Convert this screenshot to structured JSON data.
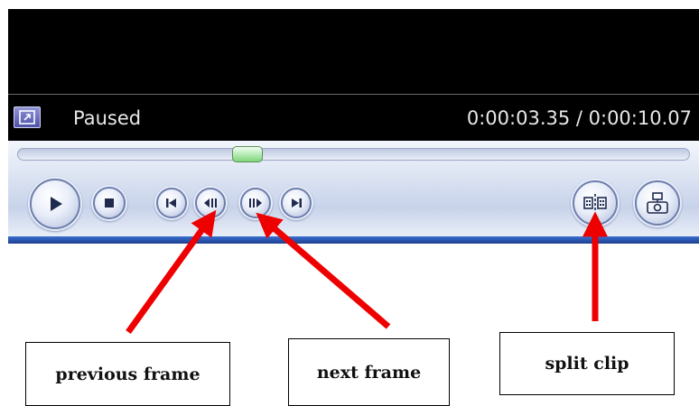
{
  "player": {
    "status": "Paused",
    "time": "0:00:03.35 / 0:00:10.07",
    "seek_progress": 0.35
  },
  "controls": {
    "play": {
      "icon": "play-icon"
    },
    "stop": {
      "icon": "stop-icon"
    },
    "previous": {
      "icon": "skip-back-icon"
    },
    "previous_frame": {
      "icon": "previous-frame-icon"
    },
    "next_frame": {
      "icon": "next-frame-icon"
    },
    "next": {
      "icon": "skip-forward-icon"
    },
    "split_clip": {
      "icon": "split-clip-icon"
    },
    "take_picture": {
      "icon": "camera-icon"
    }
  },
  "annotations": {
    "previous_frame": "previous frame",
    "next_frame": "next frame",
    "split_clip": "split clip"
  },
  "colors": {
    "arrow": "#ee0000",
    "seek_thumb": "#7ed67a",
    "control_bar_accent": "#2a5bbf"
  }
}
